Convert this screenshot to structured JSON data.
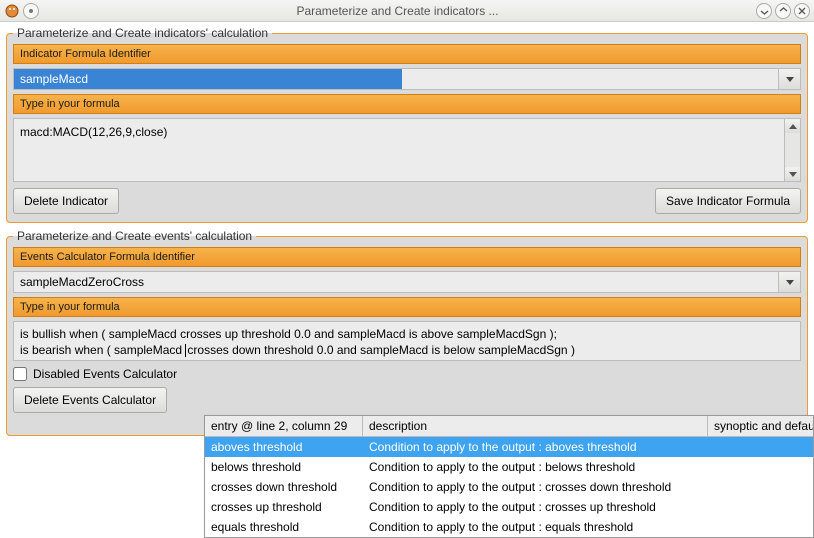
{
  "window": {
    "title": "Parameterize and Create indicators ..."
  },
  "indicators_group": {
    "legend": "Parameterize and Create indicators' calculation",
    "identifier_label": "Indicator Formula Identifier",
    "identifier_value": "sampleMacd",
    "formula_label": "Type in your formula",
    "formula_value": "macd:MACD(12,26,9,close)",
    "delete_btn": "Delete Indicator",
    "save_btn": "Save Indicator Formula"
  },
  "events_group": {
    "legend": "Parameterize and Create events' calculation",
    "identifier_label": "Events Calculator Formula Identifier",
    "identifier_value": "sampleMacdZeroCross",
    "formula_label": "Type in your formula",
    "formula_line1": "is bullish when ( sampleMacd crosses up threshold 0.0 and sampleMacd is above sampleMacdSgn );",
    "formula_line2_a": "is bearish when ( sampleMacd ",
    "formula_line2_b": "crosses down threshold 0.0 and sampleMacd is below sampleMacdSgn )",
    "disabled_checkbox_label": "Disabled Events Calculator",
    "delete_btn": "Delete Events Calculator"
  },
  "autocomplete": {
    "header_entry": "entry @ line 2, column 29",
    "header_desc": "description",
    "header_syn": "synoptic and defaul",
    "rows": [
      {
        "entry": "aboves threshold",
        "desc": "Condition to apply to the output : aboves threshold",
        "selected": true
      },
      {
        "entry": "belows threshold",
        "desc": "Condition to apply to the output : belows threshold",
        "selected": false
      },
      {
        "entry": "crosses down threshold",
        "desc": "Condition to apply to the output : crosses down threshold",
        "selected": false
      },
      {
        "entry": "crosses up threshold",
        "desc": "Condition to apply to the output : crosses up threshold",
        "selected": false
      },
      {
        "entry": "equals threshold",
        "desc": "Condition to apply to the output : equals threshold",
        "selected": false
      }
    ]
  }
}
